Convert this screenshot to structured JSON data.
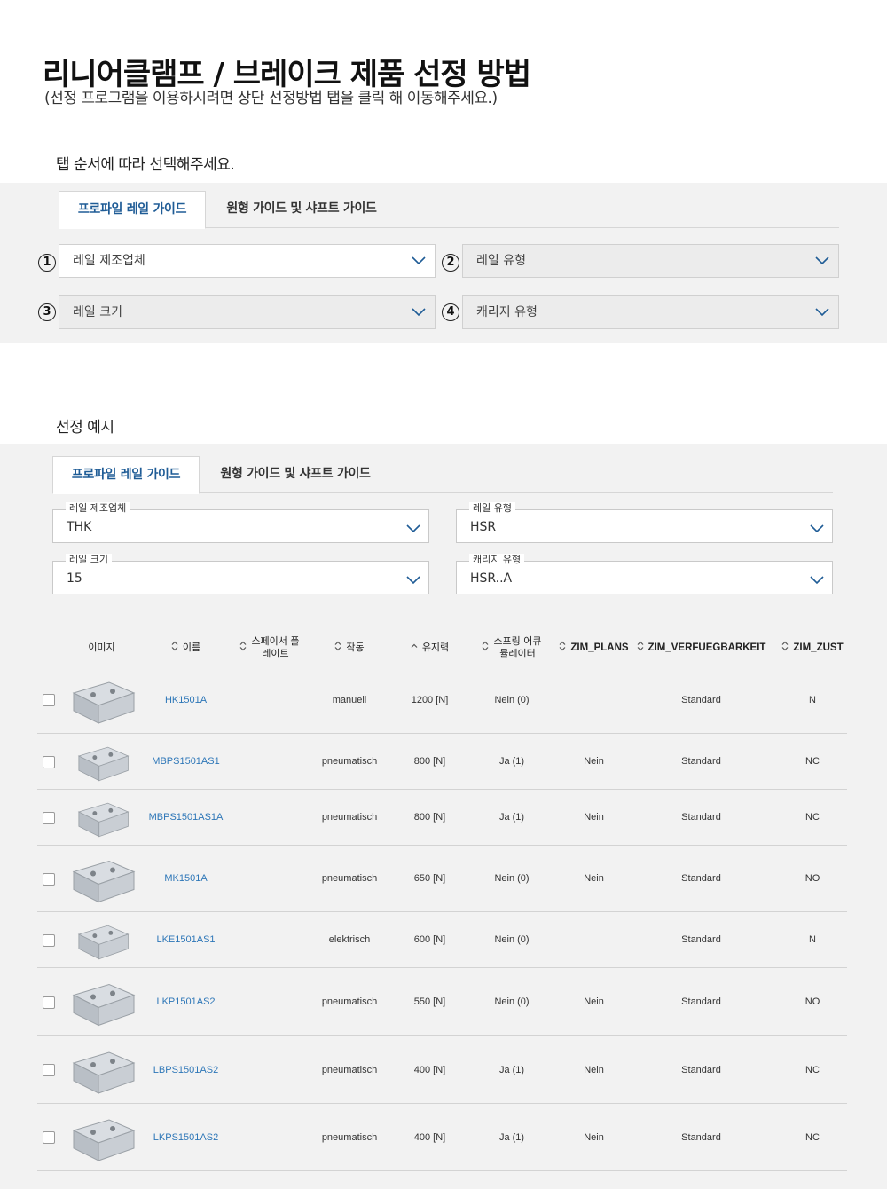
{
  "header": {
    "title": "리니어클램프 / 브레이크 제품 선정 방법",
    "subtitle": "(선정 프로그램을 이용하시려면 상단 선정방법 탭을 클릭 해 이동해주세요.)"
  },
  "step_section": {
    "heading": "탭 순서에 따라 선택해주세요.",
    "tabs": [
      "프로파일 레일 가이드",
      "원형 가이드 및 샤프트 가이드"
    ],
    "badges": [
      "1",
      "2",
      "3",
      "4"
    ],
    "selects": [
      "레일 제조업체",
      "레일 유형",
      "레일 크기",
      "캐리지 유형"
    ]
  },
  "example_section": {
    "heading": "선정 예시",
    "tabs": [
      "프로파일 레일 가이드",
      "원형 가이드 및 샤프트 가이드"
    ],
    "fields": [
      {
        "label": "레일 제조업체",
        "value": "THK"
      },
      {
        "label": "레일 유형",
        "value": "HSR"
      },
      {
        "label": "레일 크기",
        "value": "15"
      },
      {
        "label": "캐리지 유형",
        "value": "HSR..A"
      }
    ]
  },
  "table": {
    "columns": {
      "image": "이미지",
      "name": "이름",
      "spacer": "스페이서 플\n레이트",
      "action": "작동",
      "force": "유지력",
      "spring": "스프링 어큐\n뮬레이터",
      "plans": "ZIM_PLANS",
      "avail": "ZIM_VERFUEGBARKEIT",
      "zust": "ZIM_ZUST"
    },
    "rows": [
      {
        "name": "HK1501A",
        "spacer": "",
        "action": "manuell",
        "force": "1200 [N]",
        "spring": "Nein (0)",
        "plans": "",
        "avail": "Standard",
        "zust": "N"
      },
      {
        "name": "MBPS1501AS1",
        "spacer": "",
        "action": "pneumatisch",
        "force": "800 [N]",
        "spring": "Ja (1)",
        "plans": "Nein",
        "avail": "Standard",
        "zust": "NC"
      },
      {
        "name": "MBPS1501AS1A",
        "spacer": "",
        "action": "pneumatisch",
        "force": "800 [N]",
        "spring": "Ja (1)",
        "plans": "Nein",
        "avail": "Standard",
        "zust": "NC"
      },
      {
        "name": "MK1501A",
        "spacer": "",
        "action": "pneumatisch",
        "force": "650 [N]",
        "spring": "Nein (0)",
        "plans": "Nein",
        "avail": "Standard",
        "zust": "NO"
      },
      {
        "name": "LKE1501AS1",
        "spacer": "",
        "action": "elektrisch",
        "force": "600 [N]",
        "spring": "Nein (0)",
        "plans": "",
        "avail": "Standard",
        "zust": "N"
      },
      {
        "name": "LKP1501AS2",
        "spacer": "",
        "action": "pneumatisch",
        "force": "550 [N]",
        "spring": "Nein (0)",
        "plans": "Nein",
        "avail": "Standard",
        "zust": "NO"
      },
      {
        "name": "LBPS1501AS2",
        "spacer": "",
        "action": "pneumatisch",
        "force": "400 [N]",
        "spring": "Ja (1)",
        "plans": "Nein",
        "avail": "Standard",
        "zust": "NC"
      },
      {
        "name": "LKPS1501AS2",
        "spacer": "",
        "action": "pneumatisch",
        "force": "400 [N]",
        "spring": "Ja (1)",
        "plans": "Nein",
        "avail": "Standard",
        "zust": "NC"
      }
    ]
  },
  "colors": {
    "accent": "#1f5c96",
    "link": "#2e77b8",
    "panel": "#f2f2f2"
  }
}
